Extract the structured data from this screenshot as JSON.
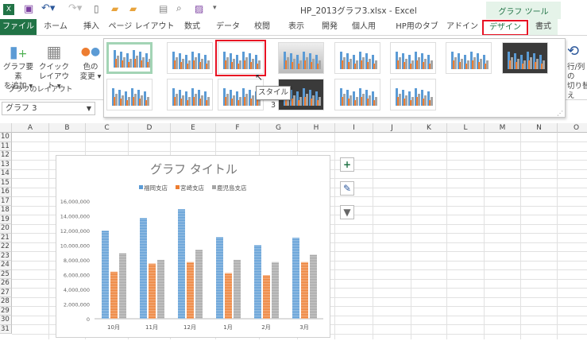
{
  "window": {
    "title": "HP_2013グラフ3.xlsx - Excel",
    "context_tab_group": "グラフ ツール"
  },
  "ribbon_tabs": [
    "ファイル",
    "ホーム",
    "挿入",
    "ページ レイアウト",
    "数式",
    "データ",
    "校閲",
    "表示",
    "開発",
    "個人用",
    "HP用のタブ",
    "アドイン",
    "デザイン",
    "書式"
  ],
  "ribbon": {
    "add_element": [
      "グラフ要素",
      "を追加 ▾"
    ],
    "quick_layout": [
      "クイック",
      "レイアウト ▾"
    ],
    "change_colors": [
      "色の",
      "変更 ▾"
    ],
    "group_label": "グラフのレイアウト",
    "switch_row_col": [
      "行/列の",
      "切り替え"
    ],
    "tooltip": "スタイル 3",
    "selected_style": 3
  },
  "name_box": "グラフ 3",
  "columns": [
    "A",
    "B",
    "C",
    "D",
    "E",
    "F",
    "G",
    "H",
    "I",
    "J",
    "K",
    "L",
    "M",
    "N",
    "O"
  ],
  "rows": [
    "10",
    "11",
    "12",
    "13",
    "14",
    "15",
    "16",
    "17",
    "18",
    "19",
    "20",
    "21",
    "22",
    "23",
    "24",
    "25",
    "26",
    "27",
    "28",
    "29",
    "30",
    "31"
  ],
  "colors": {
    "excel_green": "#217346",
    "series1": "#5b9bd5",
    "series2": "#ed7d31",
    "series3": "#a5a5a5",
    "highlight": "#e81123"
  },
  "chart_data": {
    "type": "bar",
    "title": "グラフ タイトル",
    "categories": [
      "10月",
      "11月",
      "12月",
      "1月",
      "2月",
      "3月"
    ],
    "series": [
      {
        "name": "福岡支店",
        "values": [
          12000000,
          13700000,
          14900000,
          11100000,
          10000000,
          11000000
        ]
      },
      {
        "name": "宮崎支店",
        "values": [
          6400000,
          7500000,
          7700000,
          6200000,
          5900000,
          7700000
        ]
      },
      {
        "name": "鹿児島支店",
        "values": [
          8900000,
          8000000,
          9400000,
          8000000,
          7700000,
          8700000
        ]
      }
    ],
    "ylim": [
      0,
      16000000
    ],
    "yticks": [
      "0",
      "2,000,000",
      "4,000,000",
      "6,000,000",
      "8,000,000",
      "10,000,000",
      "12,000,000",
      "14,000,000",
      "16,000,000"
    ],
    "legend": "top"
  },
  "chart_buttons": {
    "add": "+",
    "style": "✎",
    "filter": "▼"
  }
}
